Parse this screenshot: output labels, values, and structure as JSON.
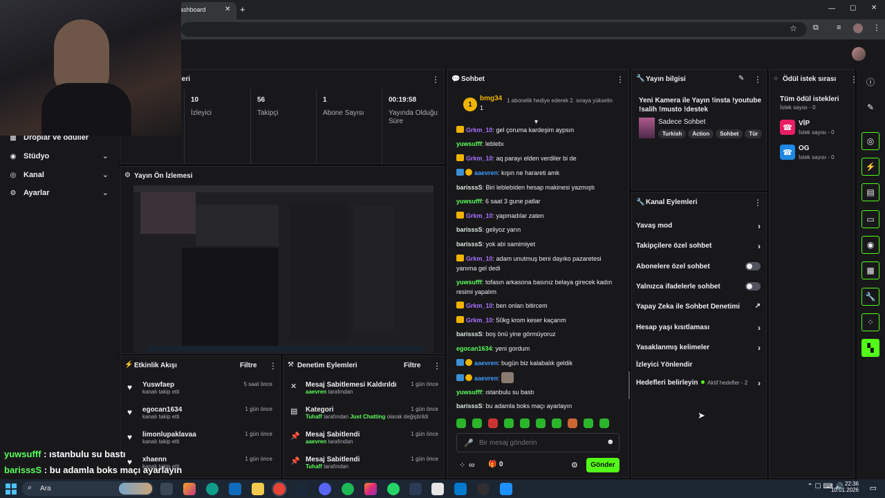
{
  "browser": {
    "tab_title": "ashboard",
    "new_tab": "+",
    "win_min": "—",
    "win_max": "▢",
    "win_close": "✕"
  },
  "nav": {
    "items": [
      {
        "label": "Droplar ve ödüller"
      },
      {
        "label": "Stüdyo"
      },
      {
        "label": "Kanal"
      },
      {
        "label": "Ayarlar"
      }
    ]
  },
  "stats": {
    "title_fragment": "leri",
    "items": [
      {
        "value": "10",
        "label": "İzleyici"
      },
      {
        "value": "56",
        "label": "Takipçi"
      },
      {
        "value": "1",
        "label": "Abone Sayısı"
      },
      {
        "value": "00:19:58",
        "label": "Yayında Olduğu Süre"
      }
    ]
  },
  "preview": {
    "title": "Yayın Ön İzlemesi"
  },
  "activity": {
    "title": "Etkinlik Akışı",
    "filter": "Filtre",
    "items": [
      {
        "name": "Yuswfaep",
        "sub": "kanalı takip etti",
        "time": "5 saat önce"
      },
      {
        "name": "egocan1634",
        "sub": "kanalı takip etti",
        "time": "1 gün önce"
      },
      {
        "name": "limonlupaklavaa",
        "sub": "kanalı takip etti",
        "time": "1 gün önce"
      },
      {
        "name": "xhaenn",
        "sub": "kanalı takip etti",
        "time": "1 gün önce"
      }
    ]
  },
  "moderation": {
    "title": "Denetim Eylemleri",
    "filter": "Filtre",
    "items": [
      {
        "title": "Mesaj Sabitlemesi Kaldırıldı",
        "actor": "aaevren",
        "rest": " tarafından",
        "time": "1 gün önce"
      },
      {
        "title": "Kategori",
        "actor": "Tuhaff",
        "rest": " tarafından ",
        "extra": "Just Chatting",
        "rest2": " olarak değiştirildi",
        "time": "1 gün önce"
      },
      {
        "title": "Mesaj Sabitlendi",
        "actor": "aaevren",
        "rest": " tarafından",
        "time": "1 gün önce"
      },
      {
        "title": "Mesaj Sabitlendi",
        "actor": "Tuhaff",
        "rest": " tarafından",
        "time": "1 gün önce"
      }
    ]
  },
  "chat": {
    "title": "Sohbet",
    "gift_user": "bmg34",
    "gift_count": "1",
    "gift_text": "1 abonelik hediye ederek 2. sıraya yükselin",
    "messages": [
      {
        "user": "Grkm_10",
        "color": "purple",
        "badge": "crown",
        "text": "gel çoruma kardeşim aypsın"
      },
      {
        "user": "yuwsufff",
        "color": "green",
        "badge": "",
        "text": "leblebı"
      },
      {
        "user": "Grkm_10",
        "color": "purple",
        "badge": "crown",
        "text": "aq parayı elden verdiler bi de"
      },
      {
        "user": "aaevren",
        "color": "blue",
        "badge": "mod",
        "text": "kışın ne harareti amk"
      },
      {
        "user": "barisssS",
        "color": "white",
        "badge": "",
        "text": "Biri leblebiden hesap makinesi yazmıştı"
      },
      {
        "user": "yuwsufff",
        "color": "green",
        "badge": "",
        "text": "6 saat 3 gune patlar"
      },
      {
        "user": "Grkm_10",
        "color": "purple",
        "badge": "crown",
        "text": "yapmadılar zaten"
      },
      {
        "user": "barisssS",
        "color": "white",
        "badge": "",
        "text": "geliyoz yarın"
      },
      {
        "user": "barisssS",
        "color": "white",
        "badge": "",
        "text": "yok abi samimiyet"
      },
      {
        "user": "Grkm_10",
        "color": "purple",
        "badge": "crown",
        "text": "adam unutmuş beni dayıko pazaretesi yanıma gel dedi"
      },
      {
        "user": "yuwsufff",
        "color": "green",
        "badge": "",
        "text": "tofasın arkasona basınız belaya girecek kadın resimi yapalım"
      },
      {
        "user": "Grkm_10",
        "color": "purple",
        "badge": "crown",
        "text": "ben onları bitircem"
      },
      {
        "user": "Grkm_10",
        "color": "purple",
        "badge": "crown",
        "text": "50kg krom keser kaçarım"
      },
      {
        "user": "barisssS",
        "color": "white",
        "badge": "",
        "text": "boş önü yine görmüyoruz"
      },
      {
        "user": "egocan1634",
        "color": "green",
        "badge": "",
        "text": "yeni gordum"
      },
      {
        "user": "aaevren",
        "color": "blue",
        "badge": "mod",
        "text": "bugün biz kalabalık geldik"
      },
      {
        "user": "aaevren",
        "color": "blue",
        "badge": "mod",
        "text": ""
      },
      {
        "user": "yuwsufff",
        "color": "green",
        "badge": "",
        "text": "ıstanbulu su bastı"
      },
      {
        "user": "barisssS",
        "color": "white",
        "badge": "",
        "text": "bu adamla boks maçı ayarlayın"
      }
    ],
    "placeholder": "Bir mesaj gönderin",
    "send": "Gönder",
    "points": "0",
    "infinity": "∞"
  },
  "stream_info": {
    "title": "Yayın bilgisi",
    "stream_title": "Yeni Kamera ile Yayın !insta !youtube !salih !musto !destek",
    "category": "Sadece Sohbet",
    "tags": [
      "Turkish",
      "Action",
      "Sohbet",
      "Tür"
    ]
  },
  "channel_actions": {
    "title": "Kanal Eylemleri",
    "items": [
      {
        "label": "Yavaş mod",
        "control": "chevron"
      },
      {
        "label": "Takipçilere özel sohbet",
        "control": "chevron"
      },
      {
        "label": "Abonelere özel sohbet",
        "control": "toggle"
      },
      {
        "label": "Yalnızca ifadelerle sohbet",
        "control": "toggle"
      },
      {
        "label": "Yapay Zeka ile Sohbet Denetimi",
        "control": "external"
      },
      {
        "label": "Hesap yaşı kısıtlaması",
        "control": "chevron"
      },
      {
        "label": "Yasaklanmış kelimeler",
        "control": "chevron"
      },
      {
        "label": "İzleyici Yönlendir",
        "control": "none"
      },
      {
        "label": "Hedefleri belirleyin",
        "control": "chevron",
        "note": "Aktif hedefler - 2"
      }
    ]
  },
  "rewards": {
    "title": "Ödül istek sırası",
    "all": "Tüm ödül istekleri",
    "all_count": "İstek sayısı - 0",
    "items": [
      {
        "name": "VİP",
        "count": "İstek sayısı - 0",
        "color": "#e91e63"
      },
      {
        "name": "OG",
        "count": "İstek sayısı - 0",
        "color": "#1e88e5"
      }
    ]
  },
  "overlay_chat": [
    {
      "user": "yuwsufff",
      "text": " : ıstanbulu su bastı"
    },
    {
      "user": "barisssS",
      "text": " : bu adamla boks maçı ayarlayın"
    }
  ],
  "taskbar": {
    "search": "Ara",
    "time": "22:36",
    "date": "10.01.2026"
  },
  "colors": {
    "accent": "#53fc18",
    "bg": "#0e0e10",
    "panel": "#18181b"
  }
}
